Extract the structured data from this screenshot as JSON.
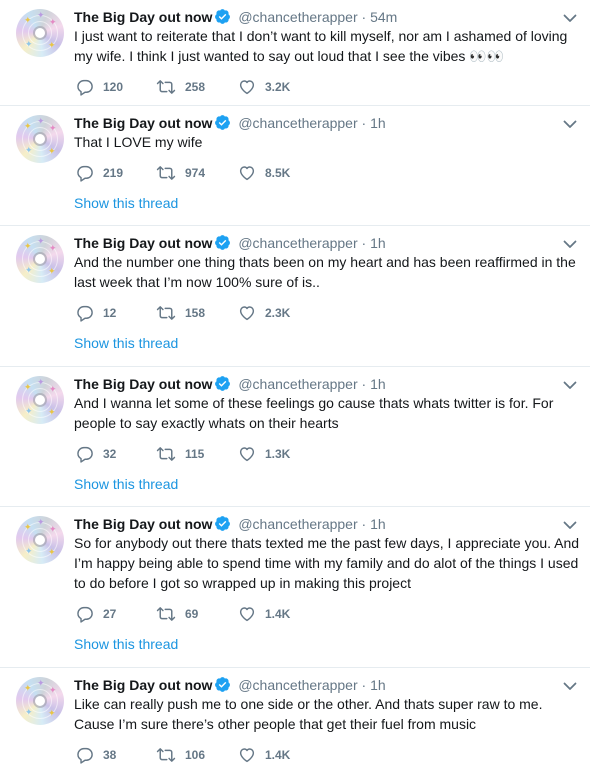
{
  "colors": {
    "link": "#1b95e0",
    "muted": "#657786",
    "text": "#14171a",
    "border": "#e6ecf0",
    "verified": "#1da1f2"
  },
  "icons": {
    "reply": "reply-icon",
    "retweet": "retweet-icon",
    "like": "like-icon",
    "verified": "verified-badge-icon",
    "menu": "chevron-down-icon"
  },
  "tweets": [
    {
      "name": "The Big Day out now",
      "handle": "@chancetherapper",
      "dot": "·",
      "time": "54m",
      "text": "I just want to reiterate that I don’t want to kill myself, nor am I ashamed of loving my wife. I think I just wanted to say out loud that I see the vibes 👀👀",
      "replies": "120",
      "retweets": "258",
      "likes": "3.2K",
      "show_thread": ""
    },
    {
      "name": "The Big Day out now",
      "handle": "@chancetherapper",
      "dot": "·",
      "time": "1h",
      "text": "That I LOVE my wife",
      "replies": "219",
      "retweets": "974",
      "likes": "8.5K",
      "show_thread": "Show this thread"
    },
    {
      "name": "The Big Day out now",
      "handle": "@chancetherapper",
      "dot": "·",
      "time": "1h",
      "text": "And the number one thing thats been on my heart and has been reaffirmed in the last week that I’m now 100% sure of is..",
      "replies": "12",
      "retweets": "158",
      "likes": "2.3K",
      "show_thread": "Show this thread"
    },
    {
      "name": "The Big Day out now",
      "handle": "@chancetherapper",
      "dot": "·",
      "time": "1h",
      "text": "And I wanna let some of these feelings go cause thats whats twitter is for. For people to say exactly whats on their hearts",
      "replies": "32",
      "retweets": "115",
      "likes": "1.3K",
      "show_thread": "Show this thread"
    },
    {
      "name": "The Big Day out now",
      "handle": "@chancetherapper",
      "dot": "·",
      "time": "1h",
      "text": "So for anybody out there thats texted me the past few days, I appreciate you. And I’m happy being able to spend time with my family and do alot of the things I used to do before I got so wrapped up in making this project",
      "replies": "27",
      "retweets": "69",
      "likes": "1.4K",
      "show_thread": "Show this thread"
    },
    {
      "name": "The Big Day out now",
      "handle": "@chancetherapper",
      "dot": "·",
      "time": "1h",
      "text": "Like can really push me to one side or the other. And thats super raw to me. Cause I’m sure there’s other people that get their fuel from music",
      "replies": "38",
      "retweets": "106",
      "likes": "1.4K",
      "show_thread": ""
    }
  ]
}
